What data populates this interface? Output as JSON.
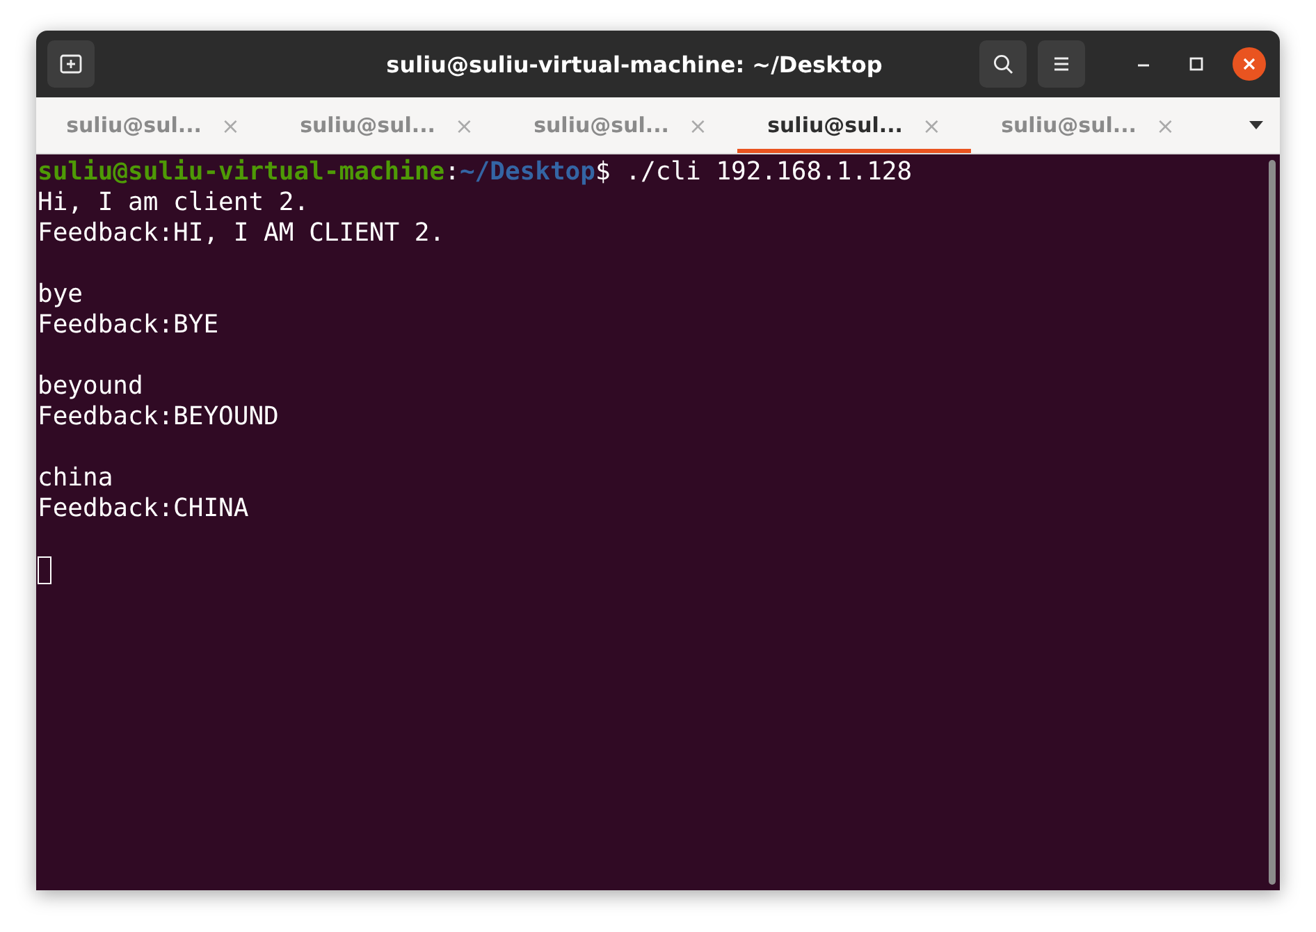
{
  "window": {
    "title": "suliu@suliu-virtual-machine: ~/Desktop"
  },
  "tabs": [
    {
      "label": "suliu@sul...",
      "selected": false,
      "close": "×"
    },
    {
      "label": "suliu@sul...",
      "selected": false,
      "close": "×"
    },
    {
      "label": "suliu@sul...",
      "selected": false,
      "close": "×"
    },
    {
      "label": "suliu@sul...",
      "selected": true,
      "close": "×"
    },
    {
      "label": "suliu@sul...",
      "selected": false,
      "close": "×"
    }
  ],
  "terminal": {
    "prompt": {
      "user": "suliu@suliu-virtual-machine",
      "separator": ":",
      "path": "~/Desktop",
      "command": "$ ./cli 192.168.1.128"
    },
    "blocks": [
      {
        "lines": [
          "Hi, I am client 2.",
          "Feedback:HI, I AM CLIENT 2."
        ]
      },
      {
        "lines": [
          "bye",
          "Feedback:BYE"
        ]
      },
      {
        "lines": [
          "beyound",
          "Feedback:BEYOUND"
        ]
      },
      {
        "lines": [
          "china",
          "Feedback:CHINA"
        ]
      }
    ]
  }
}
